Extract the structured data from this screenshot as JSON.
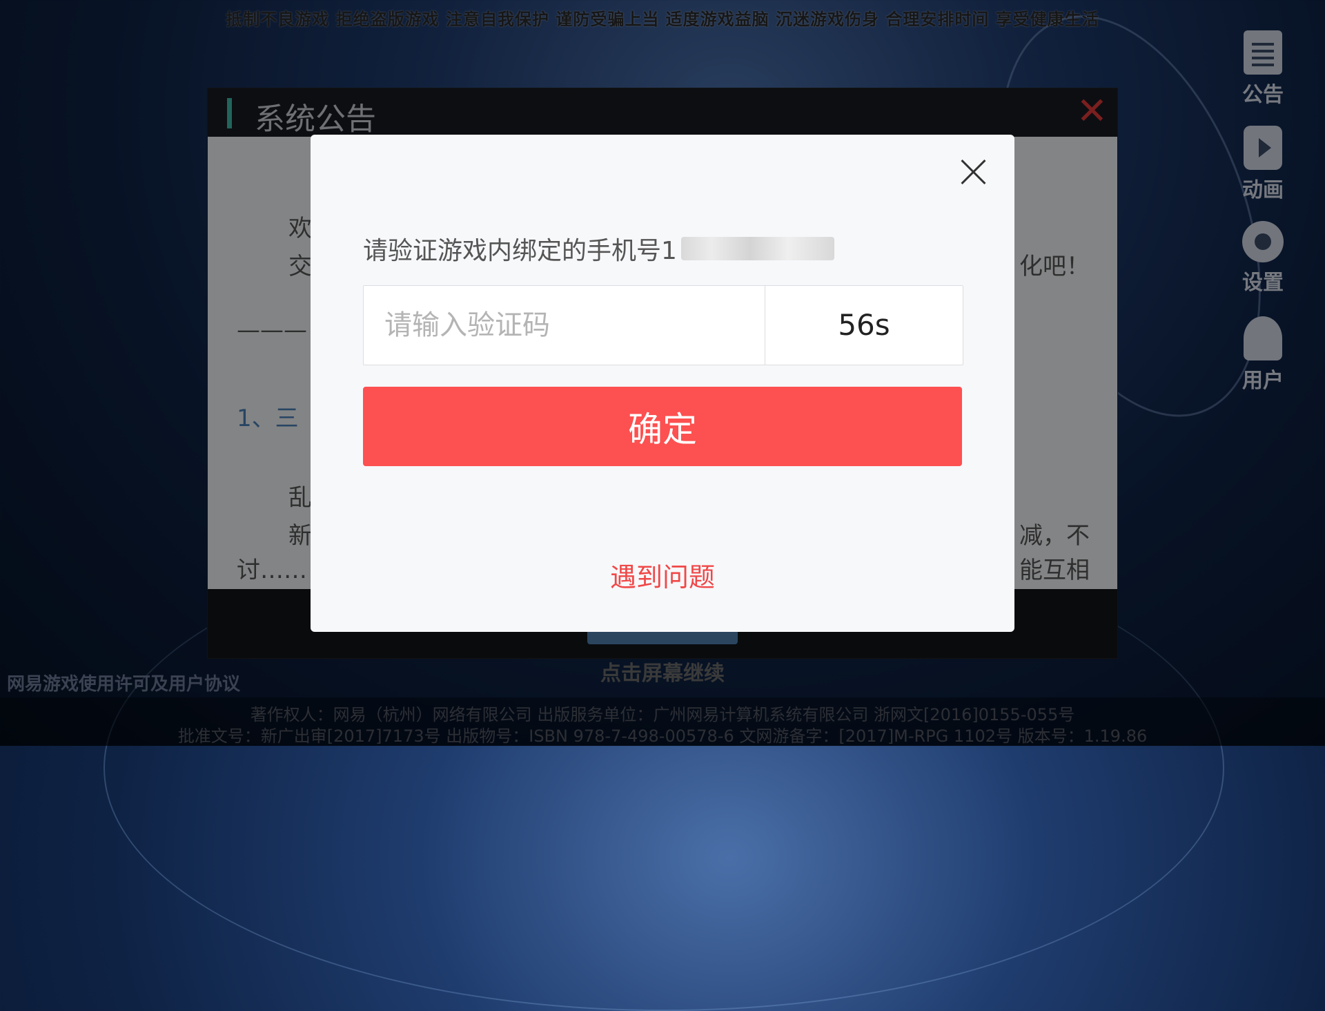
{
  "warning_bar": "抵制不良游戏 拒绝盗版游戏 注意自我保护 谨防受骗上当 适度游戏益脑 沉迷游戏伤身 合理安排时间 享受健康生活",
  "side_menu": [
    {
      "icon": "document-icon",
      "label": "公告"
    },
    {
      "icon": "play-icon",
      "label": "动画"
    },
    {
      "icon": "gear-icon",
      "label": "设置"
    },
    {
      "icon": "user-icon",
      "label": "用户"
    }
  ],
  "announcement": {
    "title": "系统公告",
    "fragments": {
      "line1_start": "欢",
      "line2_start": "交",
      "line2_end": "化吧！",
      "separator": "———",
      "item1": "1、三",
      "line3_start": "乱",
      "line4_start": "新",
      "line4_end": "减，不",
      "line5_start": "讨……",
      "line5_end": "能互相"
    }
  },
  "bottom": {
    "continue": "点击屏幕继续",
    "agreement": "网易游戏使用许可及用户协议",
    "info_line1": "著作权人：网易（杭州）网络有限公司   出版服务单位：广州网易计算机系统有限公司   浙网文[2016]0155-055号",
    "info_line2": "批准文号：新广出审[2017]7173号   出版物号：ISBN 978-7-498-00578-6   文网游备字：[2017]M-RPG 1102号   版本号：1.19.86"
  },
  "dialog": {
    "prompt": "请验证游戏内绑定的手机号1",
    "code_placeholder": "请输入验证码",
    "code_value": "",
    "countdown": "56s",
    "confirm": "确定",
    "problem": "遇到问题"
  },
  "colors": {
    "confirm_button": "#fd5050",
    "problem_link": "#f04848",
    "header_accent": "#3fb6a8",
    "close_x": "#e03a3a"
  }
}
